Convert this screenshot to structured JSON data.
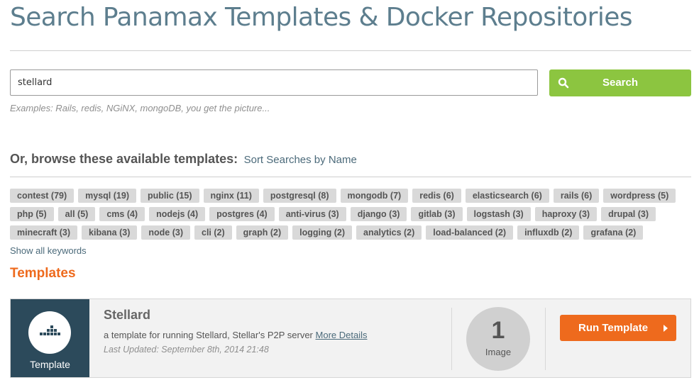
{
  "page": {
    "title": "Search Panamax Templates & Docker Repositories"
  },
  "search": {
    "value": "stellard",
    "button_label": "Search",
    "button_icon": "search-icon",
    "examples": "Examples: Rails, redis, NGiNX, mongoDB, you get the picture..."
  },
  "browse": {
    "label": "Or, browse these available templates:",
    "sort_link": "Sort Searches by Name",
    "show_all": "Show all keywords"
  },
  "tags": [
    [
      "contest (79)",
      "mysql (19)",
      "public (15)",
      "nginx (11)",
      "postgresql (8)",
      "mongodb (7)",
      "redis (6)",
      "elasticsearch (6)",
      "rails (6)",
      "wordpress (5)"
    ],
    [
      "php (5)",
      "all (5)",
      "cms (4)",
      "nodejs (4)",
      "postgres (4)",
      "anti-virus (3)",
      "django (3)",
      "gitlab (3)",
      "logstash (3)",
      "haproxy (3)",
      "drupal (3)"
    ],
    [
      "minecraft (3)",
      "kibana (3)",
      "node (3)",
      "cli (2)",
      "graph (2)",
      "logging (2)",
      "analytics (2)",
      "load-balanced (2)",
      "influxdb (2)",
      "grafana (2)"
    ]
  ],
  "templates_section": {
    "title": "Templates"
  },
  "template": {
    "side_label": "Template",
    "side_icon": "docker-containers-icon",
    "name": "Stellard",
    "description": "a template for running Stellard, Stellar's P2P server",
    "more_link": "More Details",
    "last_updated": "Last Updated: September 8th, 2014 21:48",
    "image_count": "1",
    "image_label": "Image",
    "run_label": "Run Template"
  },
  "colors": {
    "title": "#5d7e8e",
    "search_button": "#8cc540",
    "accent_orange": "#ee6a1d",
    "template_side": "#2c4a5b",
    "tag_bg": "#d9d9d9"
  }
}
